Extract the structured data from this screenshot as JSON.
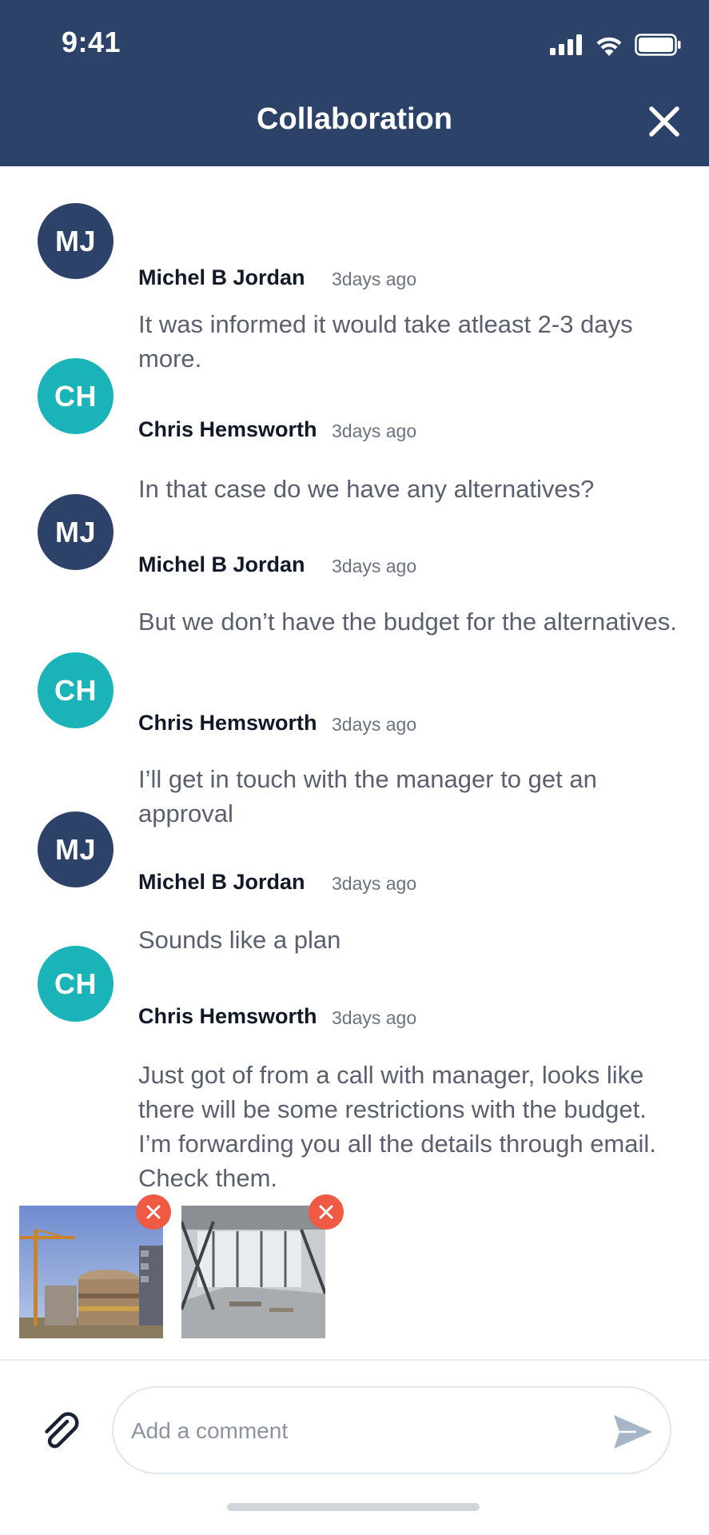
{
  "status_bar": {
    "time": "9:41"
  },
  "header": {
    "title": "Collaboration"
  },
  "messages": [
    {
      "initials": "MJ",
      "author": "Michel B Jordan",
      "time": "3days ago",
      "text": "It was informed it would take atleast 2-3 days more."
    },
    {
      "initials": "CH",
      "author": "Chris Hemsworth",
      "time": "3days ago",
      "text": "In that case do we have any alternatives?"
    },
    {
      "initials": "MJ",
      "author": "Michel B Jordan",
      "time": "3days ago",
      "text": "But we don’t have the budget for the alternatives."
    },
    {
      "initials": "CH",
      "author": "Chris Hemsworth",
      "time": "3days ago",
      "text": "I’ll get in touch with the manager to get an approval"
    },
    {
      "initials": "MJ",
      "author": "Michel B Jordan",
      "time": "3days ago",
      "text": "Sounds like a plan"
    },
    {
      "initials": "CH",
      "author": "Chris Hemsworth",
      "time": "3days ago",
      "text": "Just got of from a call with manager, looks like there will be some restrictions with the budget. I’m forwarding you all the details through email. Check them."
    }
  ],
  "composer": {
    "placeholder": "Add a comment"
  },
  "colors": {
    "header": "#2c4269",
    "mj_avatar": "#2c4269",
    "ch_avatar": "#19b3b8",
    "remove": "#ee5a43"
  }
}
